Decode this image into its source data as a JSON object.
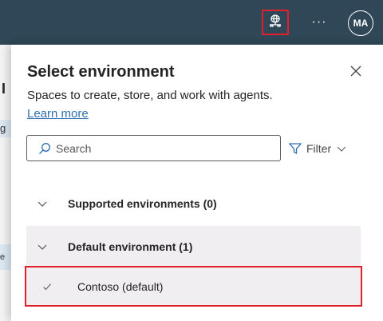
{
  "topbar": {
    "environment_icon": "globe-network-icon",
    "more_label": "···",
    "avatar_initials": "MA"
  },
  "background_app": {
    "frag1": "I",
    "frag2": "g",
    "frag3": "e"
  },
  "panel": {
    "title": "Select environment",
    "description": "Spaces to create, store, and work with agents.",
    "learn_more": "Learn more",
    "search_placeholder": "Search",
    "filter_label": "Filter",
    "groups": [
      {
        "label": "Supported environments (0)",
        "expanded": false
      },
      {
        "label": "Default environment (1)",
        "expanded": true
      }
    ],
    "items": [
      {
        "label": "Contoso (default)",
        "selected": true
      }
    ]
  },
  "colors": {
    "topbar_bg": "#2f4756",
    "highlight_red": "#e0212b",
    "link": "#2f6fb3",
    "selected_bg": "#f1eef2"
  }
}
